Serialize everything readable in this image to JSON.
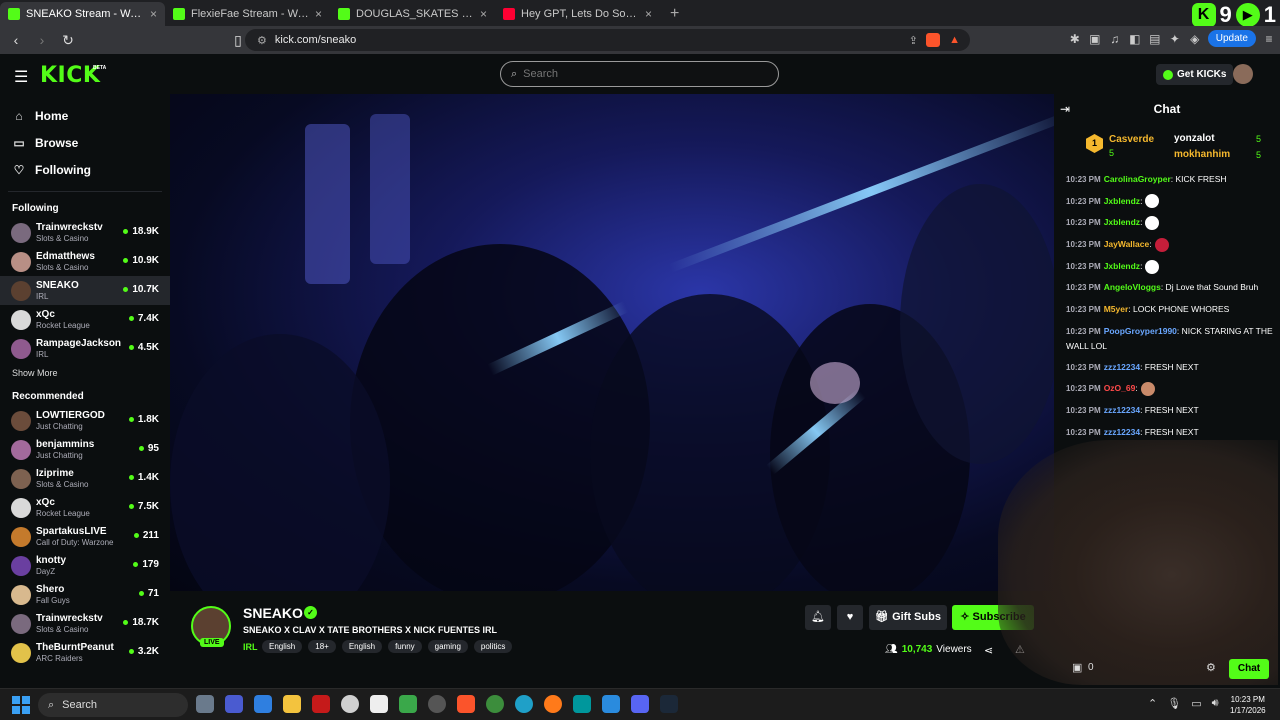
{
  "browser": {
    "tabs": [
      {
        "title": "SNEAKO Stream - Watch Live on Kick",
        "active": true,
        "icon": "kick-icon"
      },
      {
        "title": "FlexieFae Stream - Watch Live on Kick",
        "active": false,
        "icon": "kick-icon"
      },
      {
        "title": "DOUGLAS_SKATES Stream - Watch Live on Kick",
        "active": false,
        "icon": "kick-icon"
      },
      {
        "title": "Hey GPT, Lets Do Some Riddles - YouTube",
        "active": false,
        "icon": "youtube-icon"
      }
    ],
    "new_tab": "+",
    "overlay_count_a": "9",
    "overlay_count_b": "1",
    "url": "kick.com/sneako",
    "update_label": "Update"
  },
  "header": {
    "logo": "KICK",
    "beta": "BETA",
    "search_placeholder": "Search",
    "get_kicks": "Get KICKs"
  },
  "sidebar": {
    "nav": [
      {
        "label": "Home",
        "icon": "home-icon",
        "glyph": "⌂"
      },
      {
        "label": "Browse",
        "icon": "browse-icon",
        "glyph": "▭"
      },
      {
        "label": "Following",
        "icon": "heart-icon",
        "glyph": "♡"
      }
    ],
    "following_title": "Following",
    "following": [
      {
        "name": "Trainwreckstv",
        "category": "Slots & Casino",
        "viewers": "18.9K",
        "color": "#7a6a7e"
      },
      {
        "name": "Edmatthews",
        "category": "Slots & Casino",
        "viewers": "10.9K",
        "color": "#b88f85"
      },
      {
        "name": "SNEAKO",
        "category": "IRL",
        "viewers": "10.7K",
        "color": "#5b4030",
        "selected": true
      },
      {
        "name": "xQc",
        "category": "Rocket League",
        "viewers": "7.4K",
        "color": "#d9d9d9"
      },
      {
        "name": "RampageJackson",
        "category": "IRL",
        "viewers": "4.5K",
        "color": "#8f5a8e"
      }
    ],
    "show_more": "Show More",
    "recommended_title": "Recommended",
    "recommended": [
      {
        "name": "LOWTIERGOD",
        "category": "Just Chatting",
        "viewers": "1.8K",
        "color": "#6b4c3b"
      },
      {
        "name": "benjammins",
        "category": "Just Chatting",
        "viewers": "95",
        "color": "#a36a9c"
      },
      {
        "name": "Iziprime",
        "category": "Slots & Casino",
        "viewers": "1.4K",
        "color": "#7d6150"
      },
      {
        "name": "xQc",
        "category": "Rocket League",
        "viewers": "7.5K",
        "color": "#d9d9d9"
      },
      {
        "name": "SpartakusLIVE",
        "category": "Call of Duty: Warzone",
        "viewers": "211",
        "color": "#c47a2c"
      },
      {
        "name": "knotty",
        "category": "DayZ",
        "viewers": "179",
        "color": "#6a3fa0"
      },
      {
        "name": "Shero",
        "category": "Fall Guys",
        "viewers": "71",
        "color": "#d8b98e"
      },
      {
        "name": "Trainwreckstv",
        "category": "Slots & Casino",
        "viewers": "18.7K",
        "color": "#7a6a7e"
      },
      {
        "name": "TheBurntPeanut",
        "category": "ARC Raiders",
        "viewers": "3.2K",
        "color": "#e2c24a"
      }
    ]
  },
  "stream": {
    "name": "SNEAKO",
    "live": "LIVE",
    "verified_glyph": "✓",
    "title": "SNEAKO X CLAV X TATE BROTHERS X NICK FUENTES IRL",
    "category": "IRL",
    "tags": [
      "English",
      "18+",
      "English",
      "funny",
      "gaming",
      "politics"
    ],
    "gift_subs": "Gift Subs",
    "subscribe": "Subscribe",
    "viewers_count": "10,743",
    "viewers_label": "Viewers"
  },
  "chat": {
    "title": "Chat",
    "leader_rank": "1",
    "leaders": [
      {
        "name": "Casverde",
        "count": "5",
        "color": "#f5b82e"
      },
      {
        "name": "yonzalot",
        "count": "5",
        "color": "#ffffff"
      },
      {
        "name": "mokhanhim",
        "count": "5",
        "color": "#f5b82e"
      }
    ],
    "messages": [
      {
        "time": "10:23 PM",
        "user": "CarolinaGroyper",
        "color": "#53fc18",
        "text": ": KICK FRESH"
      },
      {
        "time": "10:23 PM",
        "user": "Jxblendz",
        "color": "#53fc18",
        "text": ":",
        "emote": "#ffffff"
      },
      {
        "time": "10:23 PM",
        "user": "Jxblendz",
        "color": "#53fc18",
        "text": ":",
        "emote": "#ffffff"
      },
      {
        "time": "10:23 PM",
        "user": "JayWallace",
        "color": "#f5b82e",
        "text": ":",
        "emote": "#c41e3a"
      },
      {
        "time": "10:23 PM",
        "user": "Jxblendz",
        "color": "#53fc18",
        "text": ":",
        "emote": "#ffffff"
      },
      {
        "time": "10:23 PM",
        "user": "AngeloVloggs",
        "color": "#53fc18",
        "text": ": Dj Love that Sound Bruh"
      },
      {
        "time": "10:23 PM",
        "user": "M5yer",
        "color": "#f5b82e",
        "text": ": LOCK PHONE WHORES"
      },
      {
        "time": "10:23 PM",
        "user": "PoopGroyper1990",
        "color": "#6aa7ff",
        "text": ": NICK STARING AT THE WALL LOL"
      },
      {
        "time": "10:23 PM",
        "user": "zzz12234",
        "color": "#6aa7ff",
        "text": ": FRESH NEXT"
      },
      {
        "time": "10:23 PM",
        "user": "OzO_69",
        "color": "#ff4a4a",
        "text": ":",
        "emote": "#c98a6a"
      },
      {
        "time": "10:23 PM",
        "user": "zzz12234",
        "color": "#6aa7ff",
        "text": ": FRESH NEXT"
      },
      {
        "time": "10:23 PM",
        "user": "zzz12234",
        "color": "#6aa7ff",
        "text": ": FRESH NEXT"
      }
    ],
    "kicks_count": "0",
    "chat_button": "Chat"
  },
  "taskbar": {
    "search": "Search",
    "time": "10:23 PM",
    "date": "1/17/2026"
  }
}
